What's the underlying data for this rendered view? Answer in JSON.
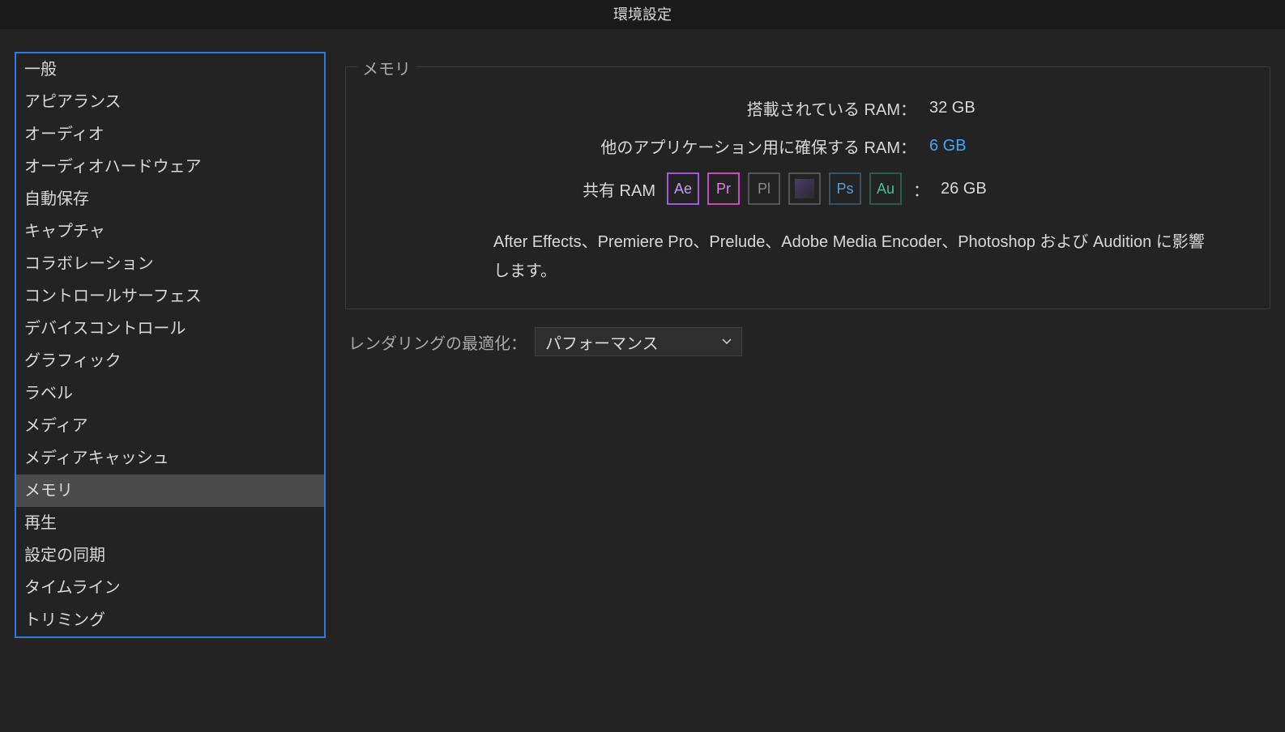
{
  "window": {
    "title": "環境設定"
  },
  "sidebar": {
    "items": [
      {
        "label": "一般"
      },
      {
        "label": "アピアランス"
      },
      {
        "label": "オーディオ"
      },
      {
        "label": "オーディオハードウェア"
      },
      {
        "label": "自動保存"
      },
      {
        "label": "キャプチャ"
      },
      {
        "label": "コラボレーション"
      },
      {
        "label": "コントロールサーフェス"
      },
      {
        "label": "デバイスコントロール"
      },
      {
        "label": "グラフィック"
      },
      {
        "label": "ラベル"
      },
      {
        "label": "メディア"
      },
      {
        "label": "メディアキャッシュ"
      },
      {
        "label": "メモリ",
        "selected": true
      },
      {
        "label": "再生"
      },
      {
        "label": "設定の同期"
      },
      {
        "label": "タイムライン"
      },
      {
        "label": "トリミング"
      }
    ]
  },
  "memory": {
    "section_title": "メモリ",
    "installed_ram_label": "搭載されている RAM：",
    "installed_ram_value": "32 GB",
    "reserved_ram_label": "他のアプリケーション用に確保する RAM：",
    "reserved_ram_value": "6 GB",
    "shared_ram_label": "共有 RAM",
    "shared_ram_value": "26 GB",
    "colon": "：",
    "apps": {
      "ae": "Ae",
      "pr": "Pr",
      "pl": "Pl",
      "ps": "Ps",
      "au": "Au"
    },
    "description": "After Effects、Premiere Pro、Prelude、Adobe Media Encoder、Photoshop および Audition に影響します。"
  },
  "rendering": {
    "label": "レンダリングの最適化：",
    "selected": "パフォーマンス"
  }
}
